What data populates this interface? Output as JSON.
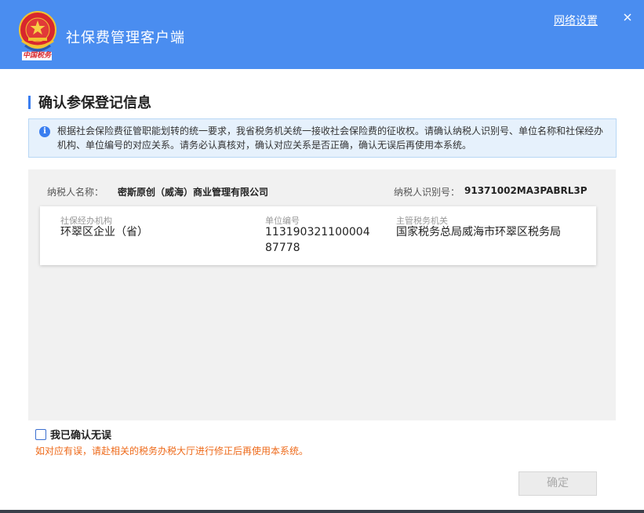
{
  "window": {
    "app_title": "社保费管理客户端",
    "network_settings": "网络设置",
    "close_icon": "close-icon",
    "logo_icon": "tax-emblem-icon",
    "logo_caption": "中国税务",
    "accent_color": "#4a8df0"
  },
  "section": {
    "title": "确认参保登记信息"
  },
  "notice": {
    "icon": "info-icon",
    "icon_glyph": "i",
    "text": "根据社会保险费征管职能划转的统一要求，我省税务机关统一接收社会保险费的征收权。请确认纳税人识别号、单位名称和社保经办机构、单位编号的对应关系。请务必认真核对，确认对应关系是否正确，确认无误后再使用本系统。"
  },
  "taxpayer": {
    "name_label": "纳税人名称：",
    "name": "密斯原创（威海）商业管理有限公司",
    "id_label": "纳税人识别号：",
    "id": "91371002MA3PABRL3P"
  },
  "registration": {
    "agency_label": "社保经办机构",
    "agency_value": "环翠区企业（省）",
    "unit_no_label": "单位编号",
    "unit_no_line1": "113190321100004",
    "unit_no_line2": "87778",
    "tax_office_label": "主管税务机关",
    "tax_office_value": "国家税务总局威海市环翠区税务局"
  },
  "confirm": {
    "checkbox_label": "我已确认无误",
    "checked": false,
    "warning": "如对应有误，请赴相关的税务办税大厅进行修正后再使用本系统。",
    "warning_color": "#ee6a1a",
    "ok_button": "确定"
  }
}
